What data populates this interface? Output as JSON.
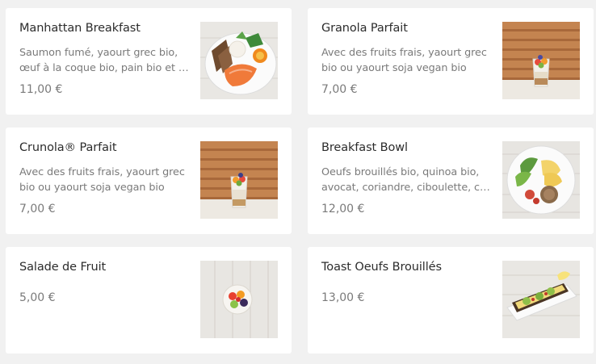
{
  "items": [
    {
      "title": "Manhattan Breakfast",
      "description": "Saumon fumé, yaourt grec bio, œuf à la coque bio, pain bio et …",
      "price": "11,00 €",
      "image": "plate-salmon-egg-bread"
    },
    {
      "title": "Granola Parfait",
      "description": "Avec des fruits frais, yaourt grec bio ou yaourt soja vegan bio",
      "price": "7,00 €",
      "image": "parfait-glass-wood-wall"
    },
    {
      "title": "Crunola® Parfait",
      "description": "Avec des fruits frais, yaourt grec bio ou yaourt soja vegan bio",
      "price": "7,00 €",
      "image": "parfait-glass-wood-wall"
    },
    {
      "title": "Breakfast Bowl",
      "description": "Oeufs brouillés bio, quinoa bio, avocat, coriandre, ciboulette, c…",
      "price": "12,00 €",
      "image": "bowl-eggs-avocado"
    },
    {
      "title": "Salade de Fruit",
      "description": "",
      "price": "5,00 €",
      "image": "fruit-cup"
    },
    {
      "title": "Toast Oeufs Brouillés",
      "description": "",
      "price": "13,00 €",
      "image": "toast-eggs-avocado"
    }
  ]
}
